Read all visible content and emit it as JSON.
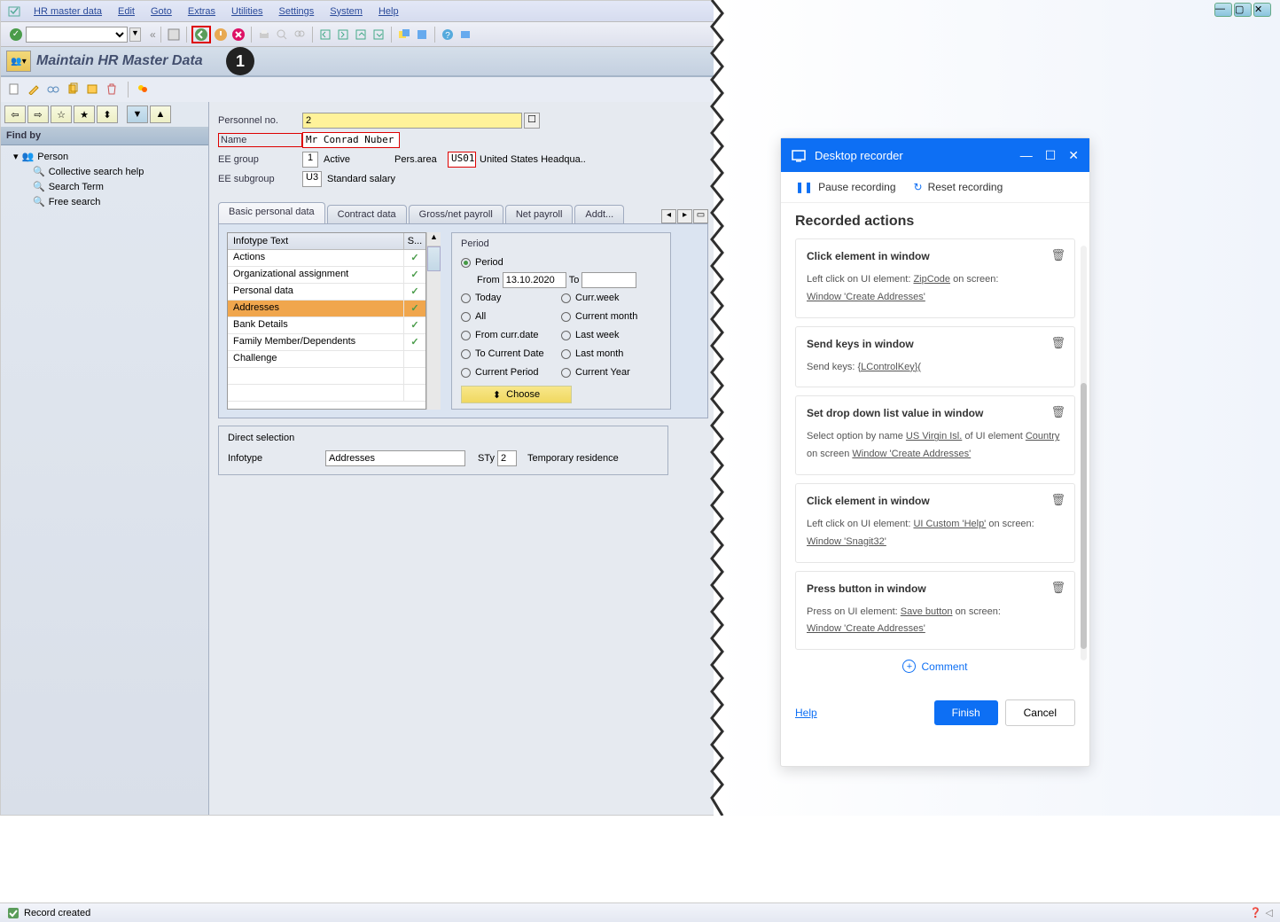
{
  "menu": [
    "HR master data",
    "Edit",
    "Goto",
    "Extras",
    "Utilities",
    "Settings",
    "System",
    "Help"
  ],
  "page_title": "Maintain HR Master Data",
  "marker1": "1",
  "findby": {
    "title": "Find by",
    "root": "Person",
    "items": [
      "Collective search help",
      "Search Term",
      "Free search"
    ]
  },
  "fields": {
    "pernr_label": "Personnel no.",
    "pernr_value": "2",
    "name_label": "Name",
    "name_value": "Mr Conrad Nuber",
    "eegrp_label": "EE group",
    "eegrp_code": "1",
    "eegrp_text": "Active",
    "persarea_label": "Pers.area",
    "persarea_code": "US01",
    "persarea_text": "United States Headqua..",
    "eesub_label": "EE subgroup",
    "eesub_code": "U3",
    "eesub_text": "Standard salary"
  },
  "tabs": [
    "Basic personal data",
    "Contract data",
    "Gross/net payroll",
    "Net payroll",
    "Addt..."
  ],
  "infotype": {
    "hdr_text": "Infotype Text",
    "hdr_s": "S...",
    "rows": [
      {
        "text": "Actions",
        "s": "✓"
      },
      {
        "text": "Organizational assignment",
        "s": "✓"
      },
      {
        "text": "Personal data",
        "s": "✓"
      },
      {
        "text": "Addresses",
        "s": "✓"
      },
      {
        "text": "Bank Details",
        "s": "✓"
      },
      {
        "text": "Family Member/Dependents",
        "s": "✓"
      },
      {
        "text": "Challenge",
        "s": ""
      }
    ]
  },
  "period": {
    "title": "Period",
    "r_period": "Period",
    "from_label": "From",
    "from_value": "13.10.2020",
    "to_label": "To",
    "r_today": "Today",
    "r_curweek": "Curr.week",
    "r_all": "All",
    "r_curmonth": "Current month",
    "r_fromcurr": "From curr.date",
    "r_lastweek": "Last week",
    "r_tocurrent": "To Current Date",
    "r_lastmonth": "Last month",
    "r_curperiod": "Current Period",
    "r_curyear": "Current Year",
    "choose": "Choose"
  },
  "direct": {
    "title": "Direct selection",
    "infotype_label": "Infotype",
    "infotype_value": "Addresses",
    "sty_label": "STy",
    "sty_value": "2",
    "sty_text": "Temporary residence"
  },
  "status": "Record created",
  "recorder": {
    "title": "Desktop recorder",
    "pause": "Pause recording",
    "reset": "Reset recording",
    "heading": "Recorded actions",
    "a1": {
      "title": "Click element in window",
      "body_a": "Left click on UI element:",
      "body_b": "ZipCode",
      "body_c": "on screen:",
      "body_d": "Window 'Create Addresses'"
    },
    "a2": {
      "title": "Send keys in window",
      "body_a": "Send keys:",
      "body_b": "{LControlKey}("
    },
    "a3": {
      "title": "Set drop down list value in window",
      "body_a": "Select option by name",
      "body_b": "US Virgin Isl.",
      "body_c": "of UI element",
      "body_d": "Country",
      "body_e": "on screen",
      "body_f": "Window 'Create Addresses'"
    },
    "a4": {
      "title": "Click element in window",
      "body_a": "Left click on UI element:",
      "body_b": "UI Custom 'Help'",
      "body_c": "on screen:",
      "body_d": "Window 'Snagit32'"
    },
    "a5": {
      "title": "Press button in window",
      "body_a": "Press on UI element:",
      "body_b": "Save button",
      "body_c": "on screen:",
      "body_d": "Window 'Create Addresses'"
    },
    "comment": "Comment",
    "help": "Help",
    "finish": "Finish",
    "cancel": "Cancel"
  }
}
